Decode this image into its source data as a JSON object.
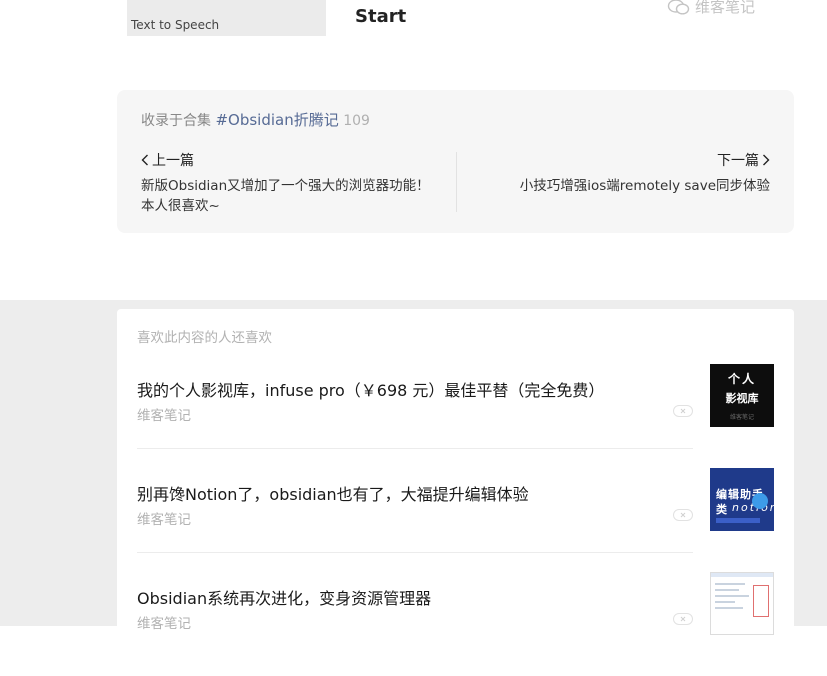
{
  "top": {
    "thumb_caption": "Text to Speech",
    "title": "Start",
    "watermark": "维客笔记"
  },
  "collection": {
    "prefix": "收录于合集",
    "tag": "#Obsidian折腾记",
    "count": "109",
    "prev": {
      "label": "上一篇",
      "title": "新版Obsidian又增加了一个强大的浏览器功能！本人很喜欢~"
    },
    "next": {
      "label": "下一篇",
      "title": "小技巧增强ios端remotely save同步体验"
    }
  },
  "recommend": {
    "heading": "喜欢此内容的人还喜欢",
    "items": [
      {
        "title": "我的个人影视库，infuse pro（￥698 元）最佳平替（完全免费）",
        "source": "维客笔记",
        "thumb": {
          "line1": "个人",
          "line2": "影视库",
          "line3": "维客笔记"
        }
      },
      {
        "title": "别再馋Notion了，obsidian也有了，大福提升编辑体验",
        "source": "维客笔记",
        "thumb": {
          "line1": "编辑助手",
          "line2": "类",
          "line3": "notion"
        }
      },
      {
        "title": "Obsidian系统再次进化，变身资源管理器",
        "source": "维客笔记",
        "thumb": {}
      }
    ]
  },
  "colors": {
    "accent": "#576b95",
    "muted": "#b2b2b2",
    "band": "#ededed"
  },
  "icons": [
    "wechat-icon",
    "chevron-left-icon",
    "chevron-right-icon",
    "close-icon"
  ]
}
